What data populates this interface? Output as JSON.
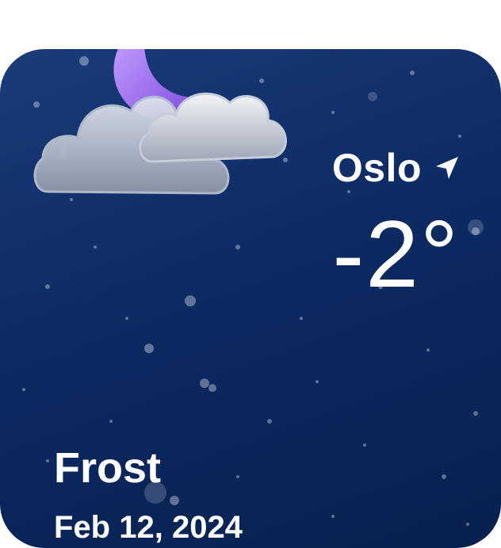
{
  "widget": {
    "city": "Oslo",
    "temperature": "-2°",
    "condition": "Frost",
    "date": "Feb 12, 2024",
    "weather_icon": "partly-cloudy-night-icon",
    "location_icon": "location-arrow-icon"
  },
  "colors": {
    "background_top": "#1a3c7a",
    "background_bottom": "#07204f",
    "text": "#ffffff",
    "moon": "#9b6cf0",
    "cloud": "#c8d0e0"
  }
}
